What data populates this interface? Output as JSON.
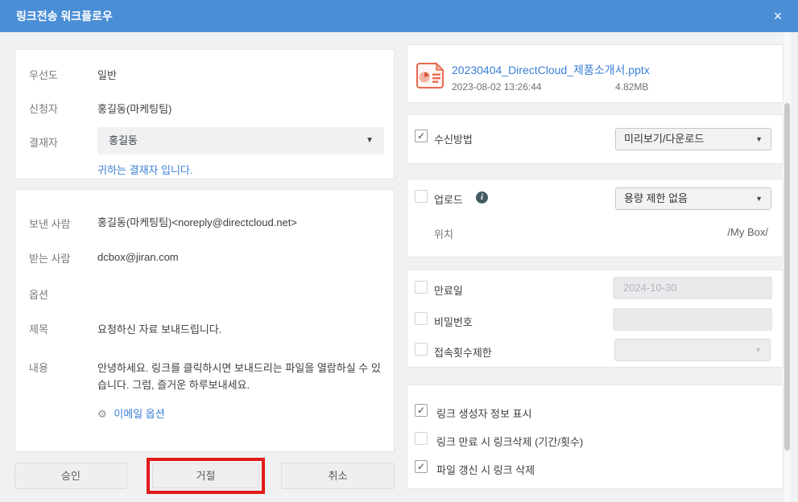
{
  "header": {
    "title": "링크전송 워크플로우",
    "close_glyph": "×"
  },
  "left": {
    "priority_label": "우선도",
    "priority_value": "일반",
    "applicant_label": "신청자",
    "applicant_value": "홍길동(마케팅팀)",
    "approver_label": "결재자",
    "approver_selected": "홍길동",
    "approver_note": "귀하는 결재자 입니다.",
    "sender_label": "보낸 사람",
    "sender_value": "홍길동(마케팅팀)<noreply@directcloud.net>",
    "recipient_label": "받는 사람",
    "recipient_value": "dcbox@jiran.com",
    "options_label": "옵션",
    "subject_label": "제목",
    "subject_value": "요청하신 자료 보내드립니다.",
    "body_label": "내용",
    "body_value": "안녕하세요. 링크를 클릭하시면 보내드리는 파일을 열람하실 수 있습니다. 그럼, 즐거운 하루보내세요.",
    "email_options_link": "이메일 옵션",
    "gear_glyph": "⚙"
  },
  "buttons": {
    "approve": "승인",
    "reject": "거절",
    "cancel": "취소"
  },
  "file": {
    "name": "20230404_DirectCloud_제품소개서.pptx",
    "date": "2023-08-02 13:26:44",
    "size": "4.82MB"
  },
  "settings": {
    "receive_label": "수신방법",
    "receive_selected": "미리보기/다운로드",
    "upload_label": "업로드",
    "upload_selected": "용량 제한 없음",
    "location_label": "위치",
    "location_value": "/My Box/",
    "expiry_label": "만료일",
    "expiry_value": "2024-10-30",
    "password_label": "비밀번호",
    "password_value": "",
    "access_limit_label": "접속횟수제한",
    "creator_info_label": "링크 생성자 정보 표시",
    "delete_on_expire_label": "링크 만료 시 링크삭제 (기간/횟수)",
    "delete_on_update_label": "파일 갱신 시 링크 삭제"
  },
  "checks": {
    "receive": "✓",
    "upload": "",
    "expiry": "",
    "password": "",
    "access_limit": "",
    "creator_info": "✓",
    "delete_on_expire": "",
    "delete_on_update": "✓"
  },
  "glyphs": {
    "dropdown_arrow": "▼",
    "info": "i"
  },
  "colors": {
    "header_blue": "#4a8ed6",
    "link_blue": "#3a7fd5",
    "annotation_red": "#e21a1a",
    "file_icon_orange": "#e56a50"
  }
}
